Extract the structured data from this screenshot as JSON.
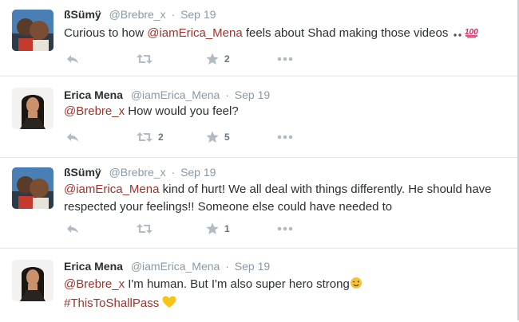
{
  "tweets": [
    {
      "name": "ßSümÿ",
      "handle": "@Brebre_x",
      "time": "Sep 19",
      "text_1": "Curious to how ",
      "mention": "@iamErica_Mena",
      "text_2": " feels about Shad making those videos ",
      "emoji": [
        "eyes",
        "hundred-points"
      ],
      "retweets": "",
      "favorites": "2"
    },
    {
      "name": "Erica Mena",
      "handle": "@iamErica_Mena",
      "time": "Sep 19",
      "mention": "@Brebre_x",
      "text": " How would you feel?",
      "retweets": "2",
      "favorites": "5"
    },
    {
      "name": "ßSümÿ",
      "handle": "@Brebre_x",
      "time": "Sep 19",
      "mention": "@iamErica_Mena",
      "text_1": " kind of hurt! We all deal with things differently. He should have",
      "text_2": "respected your feelings!! Someone else could have needed to",
      "retweets": "",
      "favorites": "1"
    },
    {
      "name": "Erica Mena",
      "handle": "@iamErica_Mena",
      "time": "Sep 19",
      "mention": "@Brebre_x",
      "text": " I'm human. But I'm also super hero strong",
      "hashtag": "#ThisToShallPass",
      "emoji": [
        "winking-face",
        "yellow-heart"
      ]
    }
  ],
  "colors": {
    "link": "#a0322b",
    "name": "#292f33",
    "meta": "#8899a6",
    "action_icon": "#b1bbc3",
    "divider": "#e1e8ed"
  },
  "separator": "·"
}
